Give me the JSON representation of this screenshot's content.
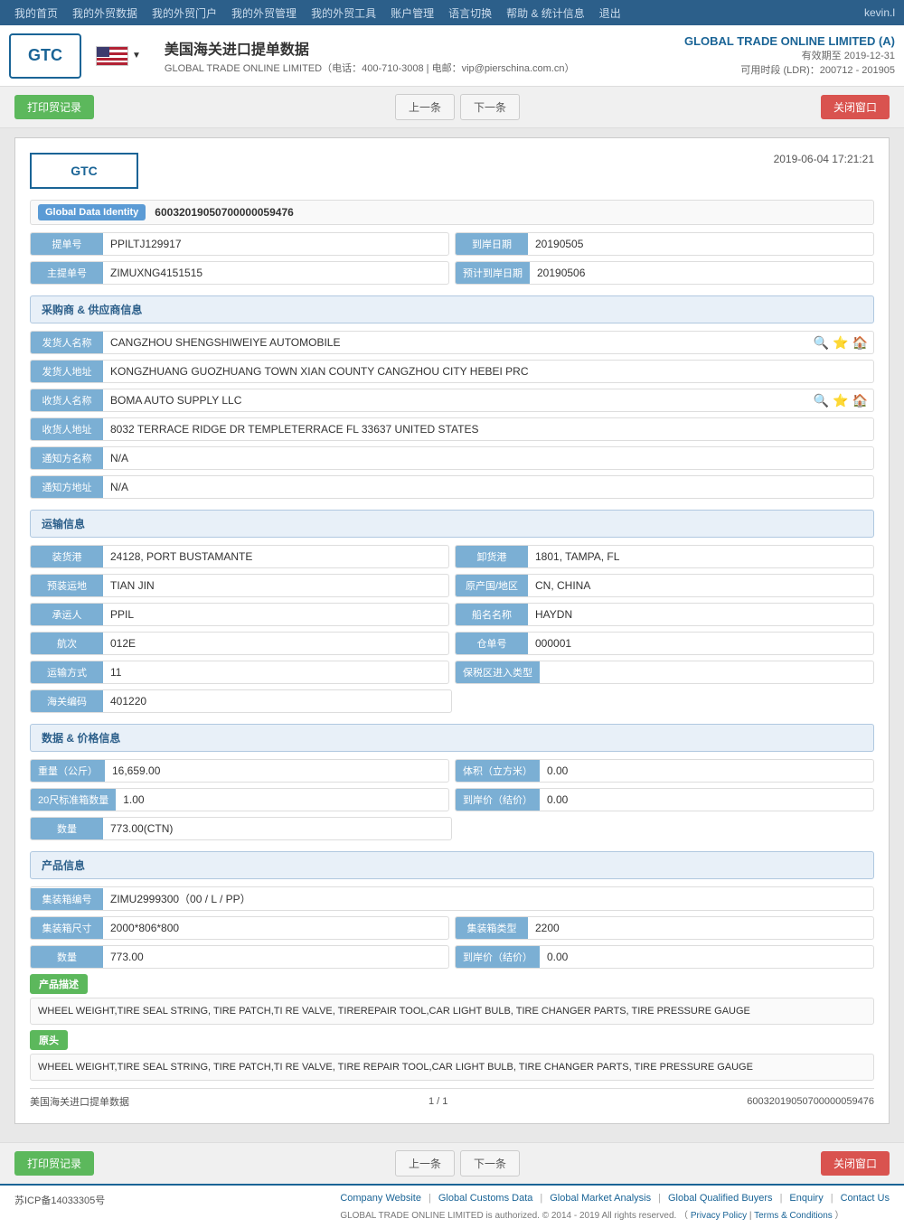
{
  "topnav": {
    "items": [
      {
        "label": "我的首页",
        "hasArrow": true
      },
      {
        "label": "我的外贸数据",
        "hasArrow": true
      },
      {
        "label": "我的外贸门户",
        "hasArrow": true
      },
      {
        "label": "我的外贸管理",
        "hasArrow": true
      },
      {
        "label": "我的外贸工具",
        "hasArrow": true
      },
      {
        "label": "账户管理",
        "hasArrow": true
      },
      {
        "label": "语言切换",
        "hasArrow": true
      },
      {
        "label": "帮助 & 统计信息",
        "hasArrow": true
      },
      {
        "label": "退出"
      }
    ],
    "user": "kevin.l"
  },
  "header": {
    "logo": "GTC",
    "title": "美国海关进口提单数据",
    "contact": "GLOBAL TRADE ONLINE LIMITED（电话：400-710-3008 | 电邮：vip@pierschina.com.cn）",
    "company": "GLOBAL TRADE ONLINE LIMITED (A)",
    "valid_until": "有效期至 2019-12-31",
    "time": "可用时段 (LDR)：200712 - 201905"
  },
  "toolbar": {
    "print_label": "打印贸记录",
    "prev_label": "上一条",
    "next_label": "下一条",
    "close_label": "关闭窗口"
  },
  "doc": {
    "logo": "GTC",
    "timestamp": "2019-06-04 17:21:21",
    "gdi_label": "Global Data Identity",
    "gdi_value": "60032019050700000059476",
    "bill_no_label": "提单号",
    "bill_no_value": "PPILTJ129917",
    "arrive_date_label": "到岸日期",
    "arrive_date_value": "20190505",
    "main_bill_label": "主提单号",
    "main_bill_value": "ZIMUXNG4151515",
    "plan_arrive_label": "预计到岸日期",
    "plan_arrive_value": "20190506",
    "sections": {
      "supplier": "采购商 & 供应商信息",
      "transport": "运输信息",
      "data_price": "数据 & 价格信息",
      "product": "产品信息"
    },
    "supplier": {
      "shipper_name_label": "发货人名称",
      "shipper_name_value": "CANGZHOU SHENGSHIWEIYE AUTOMOBILE",
      "shipper_addr_label": "发货人地址",
      "shipper_addr_value": "KONGZHUANG GUOZHUANG TOWN XIAN COUNTY CANGZHOU CITY HEBEI PRC",
      "consignee_name_label": "收货人名称",
      "consignee_name_value": "BOMA AUTO SUPPLY LLC",
      "consignee_addr_label": "收货人地址",
      "consignee_addr_value": "8032 TERRACE RIDGE DR TEMPLETERRACE FL 33637 UNITED STATES",
      "notify_name_label": "通知方名称",
      "notify_name_value": "N/A",
      "notify_addr_label": "通知方地址",
      "notify_addr_value": "N/A"
    },
    "transport": {
      "load_port_label": "装货港",
      "load_port_value": "24128, PORT BUSTAMANTE",
      "unload_port_label": "卸货港",
      "unload_port_value": "1801, TAMPA, FL",
      "preload_loc_label": "预装运地",
      "preload_loc_value": "TIAN JIN",
      "origin_label": "原产国/地区",
      "origin_value": "CN, CHINA",
      "carrier_label": "承运人",
      "carrier_value": "PPIL",
      "vessel_label": "船名名称",
      "vessel_value": "HAYDN",
      "voyage_label": "航次",
      "voyage_value": "012E",
      "warehouse_label": "仓单号",
      "warehouse_value": "000001",
      "transport_mode_label": "运输方式",
      "transport_mode_value": "11",
      "bonded_label": "保税区进入类型",
      "bonded_value": "",
      "customs_label": "海关编码",
      "customs_value": "401220"
    },
    "data_price": {
      "weight_label": "重量（公斤）",
      "weight_value": "16,659.00",
      "volume_label": "体积（立方米）",
      "volume_value": "0.00",
      "container20_label": "20尺标准箱数量",
      "container20_value": "1.00",
      "arrival_price_label": "到岸价（结价）",
      "arrival_price_value": "0.00",
      "qty_label": "数量",
      "qty_value": "773.00(CTN)"
    },
    "product": {
      "container_no_label": "集装箱编号",
      "container_no_value": "ZIMU2999300（00 / L / PP）",
      "container_size_label": "集装箱尺寸",
      "container_size_value": "2000*806*800",
      "container_type_label": "集装箱类型",
      "container_type_value": "2200",
      "qty_label": "数量",
      "qty_value": "773.00",
      "arrival_price_label": "到岸价（结价）",
      "arrival_price_value": "0.00",
      "desc_section_label": "产品描述",
      "desc_value": "WHEEL WEIGHT,TIRE SEAL STRING, TIRE PATCH,TI RE VALVE, TIREREPAIR TOOL,CAR LIGHT BULB, TIRE CHANGER PARTS, TIRE PRESSURE GAUGE",
      "original_label": "原头",
      "original_value": "WHEEL WEIGHT,TIRE SEAL STRING, TIRE PATCH,TI RE VALVE, TIRE REPAIR TOOL,CAR LIGHT BULB, TIRE CHANGER PARTS, TIRE PRESSURE GAUGE"
    },
    "footer": {
      "source": "美国海关进口提单数据",
      "page": "1 / 1",
      "id": "60032019050700000059476"
    }
  },
  "site_footer": {
    "icp": "苏ICP备14033305号",
    "links": [
      "Company Website",
      "Global Customs Data",
      "Global Market Analysis",
      "Global Qualified Buyers",
      "Enquiry",
      "Contact Us"
    ],
    "copyright": "GLOBAL TRADE ONLINE LIMITED is authorized. © 2014 - 2019 All rights reserved.",
    "privacy": "Privacy Policy",
    "terms": "Terms & Conditions"
  }
}
